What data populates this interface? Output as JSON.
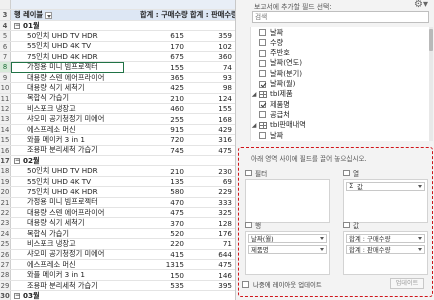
{
  "grid": {
    "top_row": {
      "num": "",
      "cells": [
        "",
        "",
        ""
      ]
    },
    "header": {
      "num": "3",
      "label": "행 레이블",
      "col1": "합계 : 구매수량",
      "col2": "합계 : 판매수량"
    },
    "rows": [
      {
        "num": "4",
        "type": "grp",
        "label": "01월",
        "v1": "",
        "v2": ""
      },
      {
        "num": "5",
        "type": "item",
        "label": "50인치 UHD TV HDR",
        "v1": "615",
        "v2": "359"
      },
      {
        "num": "6",
        "type": "item",
        "label": "55인치 UHD 4K TV",
        "v1": "170",
        "v2": "102"
      },
      {
        "num": "7",
        "type": "item",
        "label": "75인치 UHD 4K HDR",
        "v1": "675",
        "v2": "360"
      },
      {
        "num": "8",
        "type": "item",
        "label": "가정용 미니 빔프로젝터",
        "v1": "155",
        "v2": "74"
      },
      {
        "num": "9",
        "type": "item",
        "label": "대용량 스텐 에어프라이어",
        "v1": "365",
        "v2": "93"
      },
      {
        "num": "10",
        "type": "item",
        "label": "대용량 식기 세척기",
        "v1": "425",
        "v2": "98"
      },
      {
        "num": "11",
        "type": "item",
        "label": "복합식 가습기",
        "v1": "210",
        "v2": "124"
      },
      {
        "num": "12",
        "type": "item",
        "label": "비스포크 냉장고",
        "v1": "460",
        "v2": "155"
      },
      {
        "num": "13",
        "type": "item",
        "label": "샤오미 공기청정기 미에어",
        "v1": "255",
        "v2": "168"
      },
      {
        "num": "14",
        "type": "item",
        "label": "에스프레소 머신",
        "v1": "915",
        "v2": "429"
      },
      {
        "num": "15",
        "type": "item",
        "label": "와플 메이커 3 in 1",
        "v1": "720",
        "v2": "316"
      },
      {
        "num": "16",
        "type": "item",
        "label": "조용파 분리세척 가습기",
        "v1": "745",
        "v2": "475"
      },
      {
        "num": "17",
        "type": "grp",
        "label": "02월",
        "v1": "",
        "v2": ""
      },
      {
        "num": "18",
        "type": "item",
        "label": "50인치 UHD TV HDR",
        "v1": "210",
        "v2": "230"
      },
      {
        "num": "19",
        "type": "item",
        "label": "55인치 UHD 4K TV",
        "v1": "135",
        "v2": "69"
      },
      {
        "num": "20",
        "type": "item",
        "label": "75인치 UHD 4K HDR",
        "v1": "580",
        "v2": "229"
      },
      {
        "num": "21",
        "type": "item",
        "label": "가정용 미니 빔프로젝터",
        "v1": "470",
        "v2": "333"
      },
      {
        "num": "22",
        "type": "item",
        "label": "대용량 스텐 에어프라이어",
        "v1": "475",
        "v2": "325"
      },
      {
        "num": "23",
        "type": "item",
        "label": "대용량 식기 세척기",
        "v1": "370",
        "v2": "128"
      },
      {
        "num": "24",
        "type": "item",
        "label": "복합식 가습기",
        "v1": "520",
        "v2": "176"
      },
      {
        "num": "25",
        "type": "item",
        "label": "비스포크 냉장고",
        "v1": "220",
        "v2": "71"
      },
      {
        "num": "26",
        "type": "item",
        "label": "샤오미 공기청정기 미에어",
        "v1": "415",
        "v2": "644"
      },
      {
        "num": "27",
        "type": "item",
        "label": "에스프레소 머신",
        "v1": "1315",
        "v2": "475"
      },
      {
        "num": "28",
        "type": "item",
        "label": "와플 메이커 3 in 1",
        "v1": "150",
        "v2": "146"
      },
      {
        "num": "29",
        "type": "item",
        "label": "조용파 분리세척 가습기",
        "v1": "535",
        "v2": "395"
      },
      {
        "num": "30",
        "type": "grp",
        "label": "03월",
        "v1": "",
        "v2": ""
      }
    ]
  },
  "pane": {
    "choose_label": "보고서에 추가할 필드 선택:",
    "gear_icon": "gear-icon",
    "search_placeholder": "검색",
    "fields": [
      {
        "indent": 1,
        "kind": "check",
        "checked": false,
        "label": "날짜"
      },
      {
        "indent": 1,
        "kind": "check",
        "checked": false,
        "label": "수량"
      },
      {
        "indent": 1,
        "kind": "check",
        "checked": false,
        "label": "주반호"
      },
      {
        "indent": 1,
        "kind": "check",
        "checked": false,
        "label": "날짜(연도)"
      },
      {
        "indent": 1,
        "kind": "check",
        "checked": false,
        "label": "날짜(분기)"
      },
      {
        "indent": 1,
        "kind": "check",
        "checked": true,
        "label": "날짜(월)"
      },
      {
        "indent": 0,
        "kind": "table",
        "checked": false,
        "label": "tbl제품"
      },
      {
        "indent": 1,
        "kind": "check",
        "checked": true,
        "label": "제품명"
      },
      {
        "indent": 1,
        "kind": "check",
        "checked": false,
        "label": "공급처"
      },
      {
        "indent": 0,
        "kind": "table",
        "checked": false,
        "label": "tbl판매내역"
      },
      {
        "indent": 1,
        "kind": "check",
        "checked": false,
        "label": "날짜"
      }
    ]
  },
  "areas": {
    "title": "아래 영역 사이에 필드를 끌어 놓으십시오.",
    "filter": {
      "label": "필터",
      "items": []
    },
    "columns": {
      "label": "열",
      "items": [
        "값"
      ]
    },
    "rows": {
      "label": "행",
      "items": [
        "날짜(월)",
        "제품명"
      ]
    },
    "values": {
      "label": "값",
      "items": [
        "합계 : 구매수량",
        "합계 : 판매수량"
      ]
    },
    "defer_label": "나중에 레이아웃 업데이트",
    "update_label": "업데이트"
  },
  "colors": {
    "accent": "#217346",
    "highlight_border": "#d0141a",
    "header_bg": "#dde7f4"
  }
}
